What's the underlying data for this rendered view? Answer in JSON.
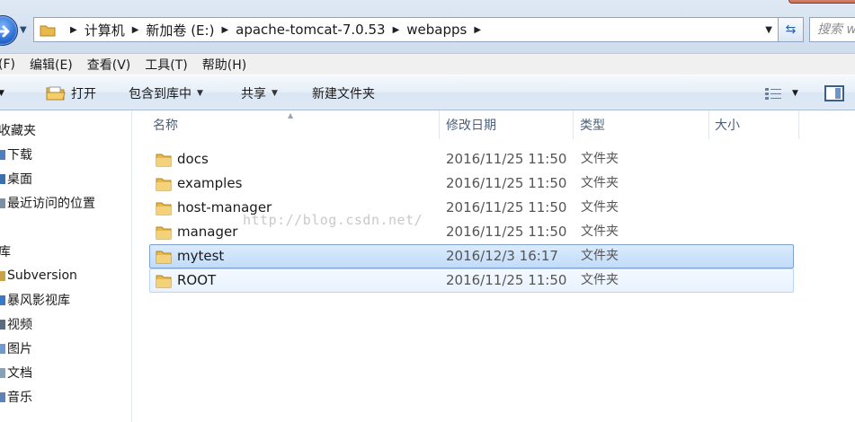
{
  "address": {
    "breadcrumbs": [
      "计算机",
      "新加卷 (E:)",
      "apache-tomcat-7.0.53",
      "webapps"
    ],
    "search_placeholder": "搜索 w"
  },
  "menu": [
    "(F)",
    "编辑(E)",
    "查看(V)",
    "工具(T)",
    "帮助(H)"
  ],
  "toolbar": {
    "open_label": "打开",
    "include_library_label": "包含到库中",
    "share_label": "共享",
    "new_folder_label": "新建文件夹"
  },
  "nav": {
    "favorites_label": "收藏夹",
    "favorites": [
      "下载",
      "桌面",
      "最近访问的位置"
    ],
    "libraries_label": "库",
    "libraries": [
      "Subversion",
      "暴风影视库",
      "视频",
      "图片",
      "文档",
      "音乐"
    ]
  },
  "columns": {
    "name": "名称",
    "date": "修改日期",
    "type": "类型",
    "size": "大小"
  },
  "files": [
    {
      "name": "docs",
      "date": "2016/11/25 11:50",
      "type": "文件夹"
    },
    {
      "name": "examples",
      "date": "2016/11/25 11:50",
      "type": "文件夹"
    },
    {
      "name": "host-manager",
      "date": "2016/11/25 11:50",
      "type": "文件夹"
    },
    {
      "name": "manager",
      "date": "2016/11/25 11:50",
      "type": "文件夹"
    },
    {
      "name": "mytest",
      "date": "2016/12/3 16:17",
      "type": "文件夹"
    },
    {
      "name": "ROOT",
      "date": "2016/11/25 11:50",
      "type": "文件夹"
    }
  ],
  "watermark": "http://blog.csdn.net/",
  "colors": {
    "selection": "#c1dcfa",
    "folder": "#e8b94a",
    "accent": "#1f5fc8"
  }
}
